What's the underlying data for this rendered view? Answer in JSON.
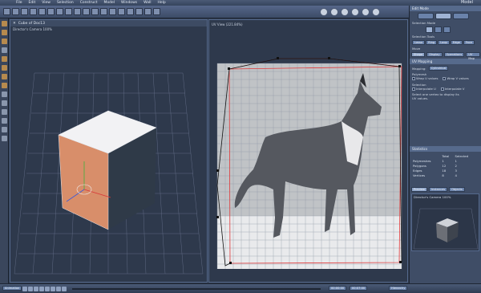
{
  "app": {
    "title": "Model"
  },
  "menu": [
    "File",
    "Edit",
    "View",
    "Selection",
    "Construct",
    "Model",
    "Windows",
    "Wall",
    "Help"
  ],
  "left_viewport": {
    "tab_label": "Cube of Doc13",
    "camera_label": "Director's Camera 100%"
  },
  "uv_viewport": {
    "label": "UV View (221.84%)"
  },
  "edit_mode": {
    "header": "Edit Mode",
    "selection_mode_label": "Selection Mode",
    "selection_tools_label": "Selection Tools",
    "tools": [
      "Lasso",
      "Ring",
      "Loop",
      "Edge",
      "Face"
    ],
    "move_label": "Move"
  },
  "panel_tabs": [
    "Shape",
    "Display",
    "Operations",
    "UV Map"
  ],
  "uv_mapping": {
    "header": "UV Mapping",
    "mapping_label": "Mapping:",
    "mapping_value": "Cylindrical",
    "polymesh_label": "Polymesh",
    "wrap_u": "Wrap U values",
    "wrap_v": "Wrap V values",
    "selection_label": "Selection",
    "interpolate_u": "Interpolate U",
    "interpolate_v": "Interpolate V",
    "hint": "Select one vertex to display its UV values."
  },
  "statistics": {
    "header": "Statistics",
    "columns": [
      "",
      "Total",
      "Selected"
    ],
    "rows": [
      [
        "Polymeshes",
        "1",
        "1"
      ],
      [
        "Polygons",
        "12",
        "2"
      ],
      [
        "Edges",
        "18",
        "3"
      ],
      [
        "Vertices",
        "8",
        "4"
      ]
    ]
  },
  "preview": {
    "tabs": [
      "Preview",
      "Instances",
      "Objects"
    ],
    "camera_label": "Director's Camera 100%"
  },
  "bottom": {
    "left_button": "Animation",
    "timecode_1": "00:00:00",
    "timecode_2": "00:07:00",
    "right_button": "Hierarchy"
  },
  "colors": {
    "accent": "#6a82aa",
    "uv_lines": "#e0393a",
    "cube_top": "#f2f2f4",
    "cube_front": "#d88e6a",
    "cube_side": "#2f3a48",
    "grid": "#8d96a3"
  }
}
